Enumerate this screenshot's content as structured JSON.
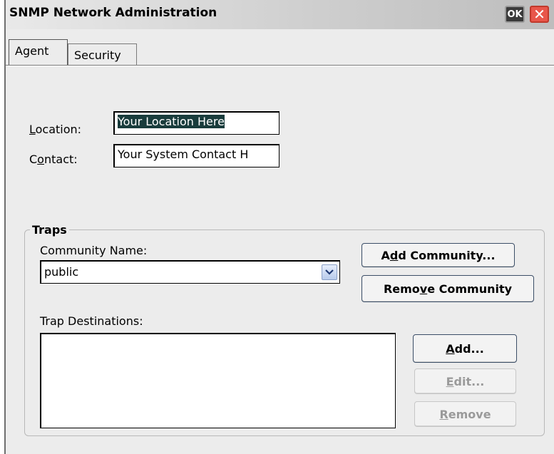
{
  "window": {
    "title": "SNMP Network Administration",
    "ok_label": "OK",
    "close_label": "✕"
  },
  "tabs": [
    {
      "label": "Agent"
    },
    {
      "label": "Security"
    }
  ],
  "agent": {
    "location_label_a": "L",
    "location_label_b": "ocation:",
    "location_value": "Your Location Here",
    "contact_label_a": "C",
    "contact_label_b": "o",
    "contact_label_c": "ntact:",
    "contact_value": "Your System Contact H"
  },
  "traps": {
    "legend": "Traps",
    "community_label": "Community Name:",
    "community_value": "public",
    "add_community_a": "A",
    "add_community_b": "d",
    "add_community_c": "d Community...",
    "remove_community_a": "Remo",
    "remove_community_b": "v",
    "remove_community_c": "e Community",
    "destinations_label": "Trap Destinations:",
    "add_a": "A",
    "add_b": "dd...",
    "edit_a": "E",
    "edit_b": "dit...",
    "remove_a": "R",
    "remove_b": "emove"
  }
}
